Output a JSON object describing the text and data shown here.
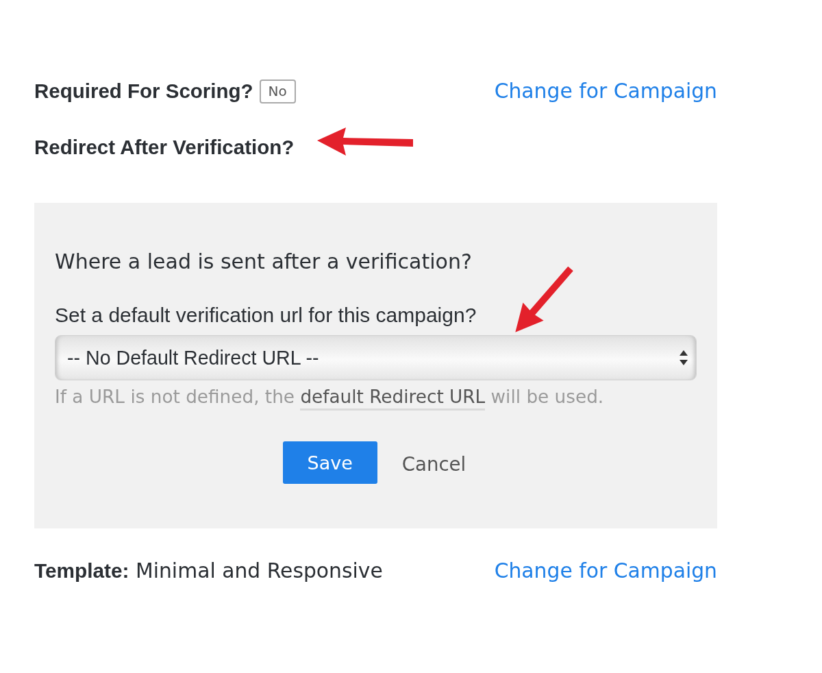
{
  "scoring": {
    "label": "Required For Scoring?",
    "value": "No",
    "link": "Change for Campaign"
  },
  "redirect": {
    "label": "Redirect After Verification?",
    "panel": {
      "question": "Where a lead is sent after a verification?",
      "select_label": "Set a default verification url for this campaign?",
      "select_value": "-- No Default Redirect URL --",
      "help_before": "If a URL is not defined, the",
      "help_link": "default Redirect URL",
      "help_after": "will be used.",
      "save": "Save",
      "cancel": "Cancel"
    }
  },
  "template": {
    "label": "Template:",
    "value": "Minimal and Responsive",
    "link": "Change for Campaign"
  },
  "annotations": [
    {
      "kind": "arrow"
    },
    {
      "kind": "arrow"
    }
  ]
}
